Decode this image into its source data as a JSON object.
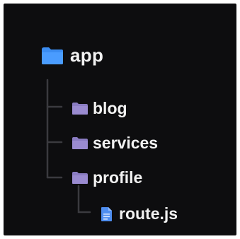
{
  "tree": {
    "root": {
      "label": "app",
      "icon": "folder-icon",
      "icon_color": "#3b8df2"
    },
    "children": [
      {
        "label": "blog",
        "icon": "folder-icon",
        "icon_color": "#9a8bd0"
      },
      {
        "label": "services",
        "icon": "folder-icon",
        "icon_color": "#9a8bd0"
      },
      {
        "label": "profile",
        "icon": "folder-icon",
        "icon_color": "#9a8bd0"
      }
    ],
    "file": {
      "label": "route.js",
      "icon": "file-icon",
      "icon_color": "#4f8ef0"
    }
  },
  "colors": {
    "background": "#0d0d0f",
    "text": "#f2f2f2",
    "connector": "#3a3a3f"
  }
}
